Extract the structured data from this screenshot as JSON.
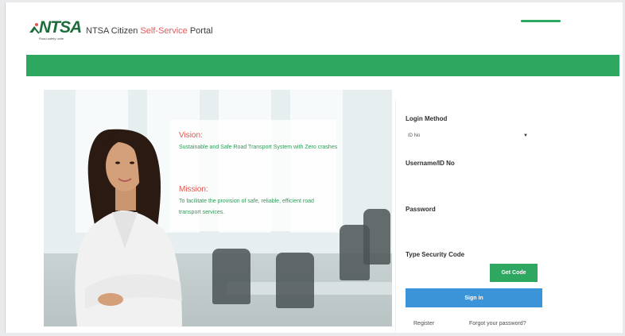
{
  "header": {
    "logo_text": "NTSA",
    "logo_tagline": "Road safety unite",
    "title_prefix": "NTSA Citizen ",
    "title_accent": "Self-Service",
    "title_suffix": " Portal",
    "menu_icon": "menu-bar-icon"
  },
  "hero": {
    "vision_heading": "Vision:",
    "vision_text": "Sustainable and Safe Road Transport System with Zero crashes",
    "mission_heading": "Mission:",
    "mission_text": "To facilitate the provision of safe, reliable, efficient road transport services."
  },
  "login": {
    "method_label": "Login Method",
    "method_value": "ID No",
    "username_label": "Username/ID No",
    "password_label": "Password",
    "security_label": "Type Security Code",
    "get_code_label": "Get Code",
    "sign_in_label": "Sign in",
    "register_label": "Register",
    "forgot_label": "Forgot your password?"
  },
  "colors": {
    "brand_green": "#2ea761",
    "sign_in_blue": "#3b94d8",
    "accent_red": "#e05b5b"
  }
}
